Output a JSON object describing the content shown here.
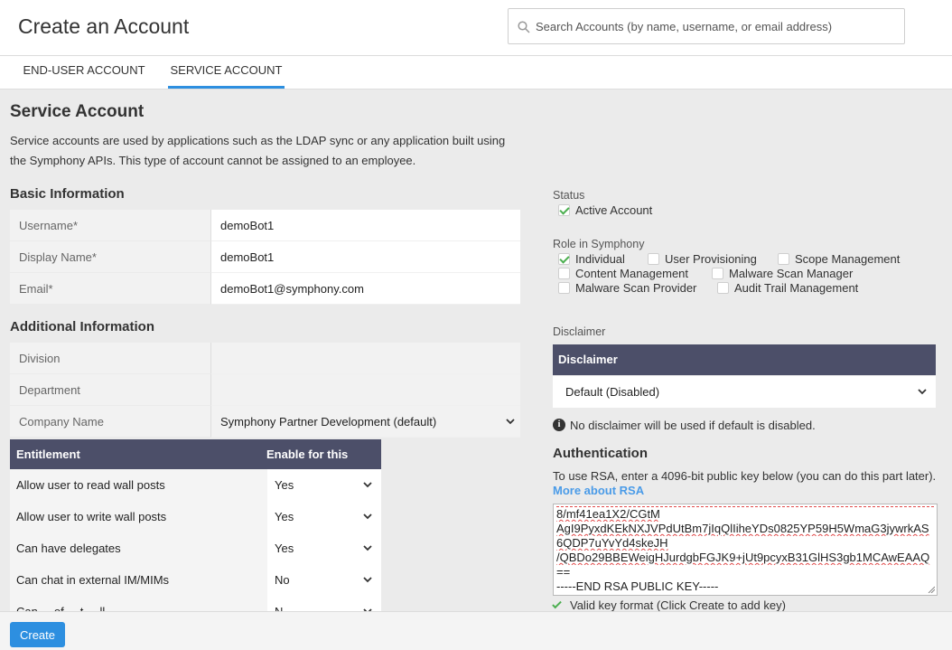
{
  "header": {
    "title": "Create an Account",
    "search_placeholder": "Search Accounts (by name, username, or email address)"
  },
  "tabs": [
    {
      "label": "END-USER ACCOUNT",
      "active": false
    },
    {
      "label": "SERVICE ACCOUNT",
      "active": true
    }
  ],
  "intro": {
    "title": "Service Account",
    "description": "Service accounts are used by applications such as the LDAP sync or any application built using the Symphony APIs. This type of account cannot be assigned to an employee."
  },
  "basic_info": {
    "heading": "Basic Information",
    "fields": [
      {
        "label": "Username*",
        "value": "demoBot1"
      },
      {
        "label": "Display Name*",
        "value": "demoBot1"
      },
      {
        "label": "Email*",
        "value": "demoBot1@symphony.com"
      }
    ]
  },
  "additional_info": {
    "heading": "Additional Information",
    "fields": [
      {
        "label": "Division",
        "value": ""
      },
      {
        "label": "Department",
        "value": ""
      },
      {
        "label": "Company Name",
        "value": "Symphony Partner Development (default)"
      }
    ]
  },
  "entitlements": {
    "col_entitlement": "Entitlement",
    "col_enable": "Enable for this user?",
    "rows": [
      {
        "name": "Allow user to read wall posts",
        "value": "Yes"
      },
      {
        "name": "Allow user to write wall posts",
        "value": "Yes"
      },
      {
        "name": "Can have delegates",
        "value": "Yes"
      },
      {
        "name": "Can chat in external IM/MIMs",
        "value": "No"
      },
      {
        "name": "Can ... of ... t ... ll",
        "value": "N..."
      }
    ]
  },
  "status": {
    "label": "Status",
    "active_label": "Active Account",
    "active_checked": true
  },
  "roles": {
    "label": "Role in Symphony",
    "items": [
      {
        "label": "Individual",
        "checked": true
      },
      {
        "label": "User Provisioning",
        "checked": false
      },
      {
        "label": "Scope Management",
        "checked": false
      },
      {
        "label": "Content Management",
        "checked": false
      },
      {
        "label": "Malware Scan Manager",
        "checked": false
      },
      {
        "label": "Malware Scan Provider",
        "checked": false
      },
      {
        "label": "Audit Trail Management",
        "checked": false
      }
    ]
  },
  "disclaimer": {
    "label": "Disclaimer",
    "header": "Disclaimer",
    "selected": "Default (Disabled)",
    "info": "No disclaimer will be used if default is disabled."
  },
  "authentication": {
    "heading": "Authentication",
    "description": "To use RSA, enter a 4096-bit public key below (you can do this part later).",
    "link": "More about RSA",
    "key_lines": [
      "8/mf41ea1X2/CGtM",
      "AgI9PyxdKEkNXJVPdUtBm7jIqQlIiheYDs0825YP59H5WmaG3jywrkAS",
      "6QDP7uYvYd4skeJH",
      "/QBDo29BBEWeigHJurdgbFGJK9+jUt9pcyxB31GlHS3gb1MCAwEAAQ",
      "==",
      "-----END RSA PUBLIC KEY-----"
    ],
    "valid_text": "Valid key format (Click Create to add key)"
  },
  "footer": {
    "create_label": "Create"
  },
  "colors": {
    "accent": "#2d8fe0",
    "table_header": "#4c4f69",
    "link": "#4a9be8",
    "check": "#4caf50"
  }
}
